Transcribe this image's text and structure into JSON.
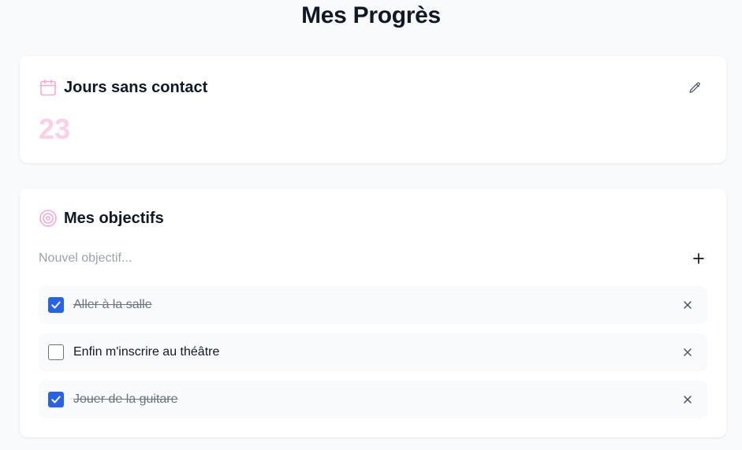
{
  "page": {
    "title": "Mes Progrès"
  },
  "days_card": {
    "title": "Jours sans contact",
    "count": "23",
    "icon": "calendar-icon",
    "edit_icon": "pencil-icon"
  },
  "goals_card": {
    "title": "Mes objectifs",
    "icon": "target-icon",
    "new_goal_placeholder": "Nouvel objectif...",
    "new_goal_value": "",
    "add_icon": "plus-icon",
    "items": [
      {
        "label": "Aller à la salle",
        "done": true
      },
      {
        "label": "Enfin m'inscrire au théâtre",
        "done": false
      },
      {
        "label": "Jouer de la guitare",
        "done": true
      }
    ]
  },
  "colors": {
    "accent_pink": "#fbcfe8",
    "check_blue": "#2563eb",
    "item_bg": "#f9fafb"
  }
}
